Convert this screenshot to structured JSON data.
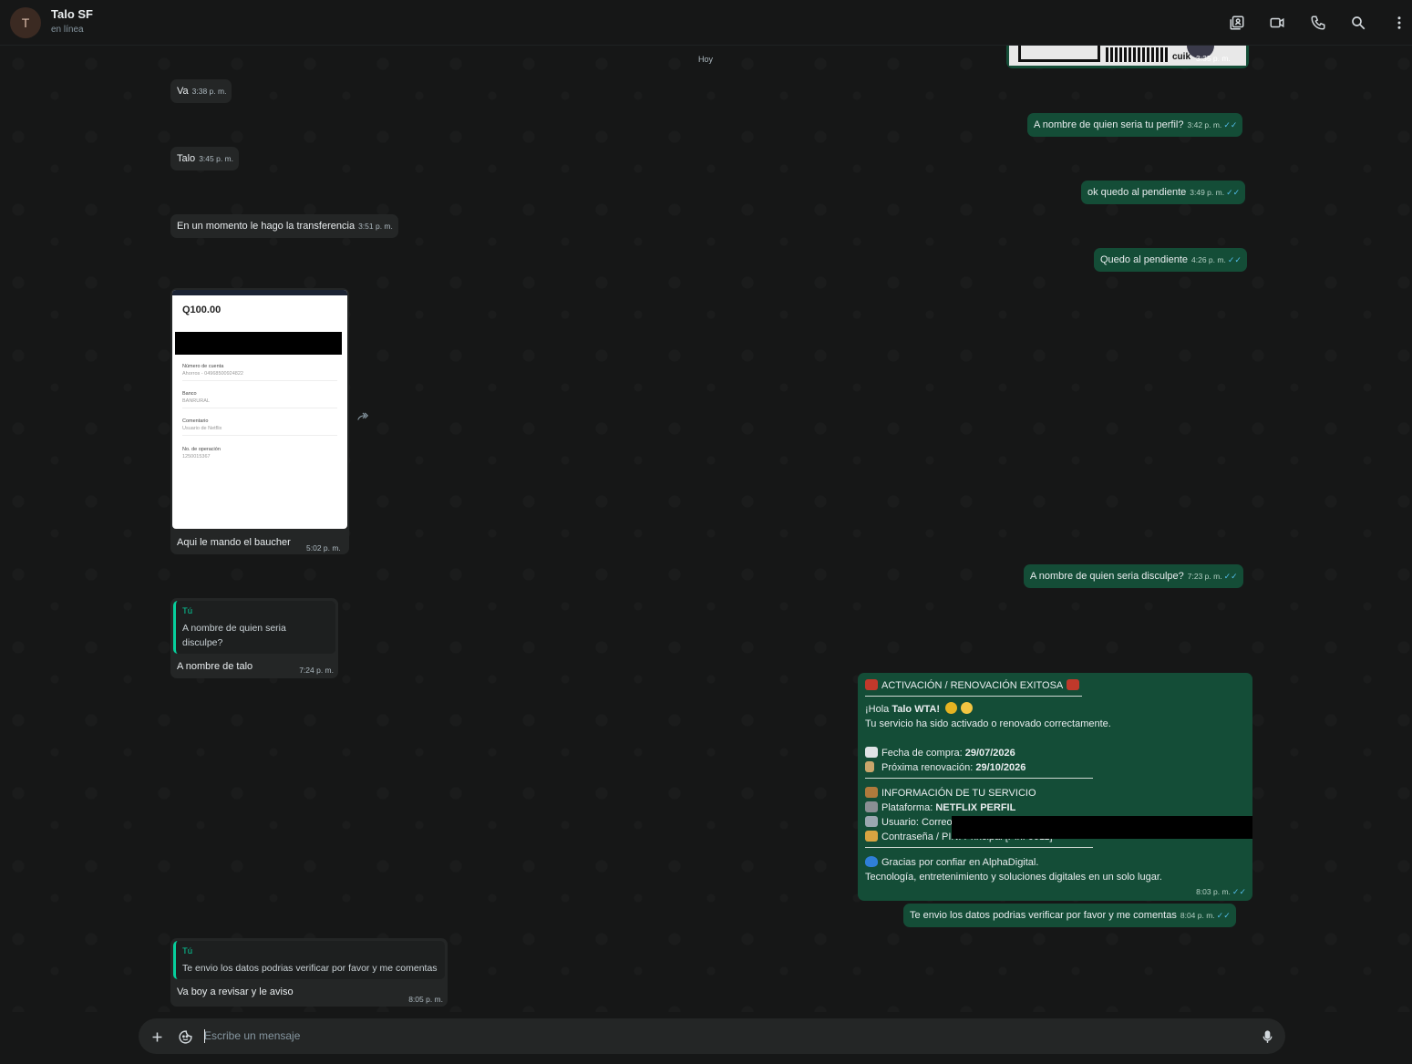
{
  "header": {
    "avatar_initial": "T",
    "contact_name": "Talo SF",
    "status": "en línea"
  },
  "chat": {
    "date_chip": "Hoy",
    "partial_out_time": "3:35 p. m.",
    "partial_out_overlay": "cuik",
    "messages_in": [
      {
        "text": "Va",
        "time": "3:38 p. m."
      },
      {
        "text": "Talo",
        "time": "3:45 p. m."
      },
      {
        "text": "En un momento  le hago la transferencia",
        "time": "3:51 p. m."
      },
      {
        "text": "Aqui le mando el baucher",
        "time": "5:02 p. m."
      },
      {
        "quote_author": "Tú",
        "quote_text": "A nombre de quien seria disculpe?",
        "text": "A nombre  de talo",
        "time": "7:24 p. m."
      },
      {
        "quote_author": "Tú",
        "quote_text": "Te envio los datos podrias verificar por favor y me comentas",
        "text": "Va boy  a revisar  y le aviso",
        "time": "8:05 p. m."
      }
    ],
    "messages_out": [
      {
        "text": "A nombre de quien seria tu perfil?",
        "time": "3:42 p. m."
      },
      {
        "text": "ok quedo al pendiente",
        "time": "3:49 p. m."
      },
      {
        "text": "Quedo al pendiente",
        "time": "4:26 p. m."
      },
      {
        "text": "A nombre de quien seria disculpe?",
        "time": "7:23 p. m."
      },
      {
        "text": "Te envio los datos podrias verificar por favor y me comentas",
        "time": "8:04 p. m."
      }
    ],
    "receipt": {
      "amount": "Q100.00",
      "fields": [
        {
          "label": "Número de cuenta",
          "value": "Ahorros - 04968500924822"
        },
        {
          "label": "Banco",
          "value": "BANRURAL"
        },
        {
          "label": "Comentario",
          "value": "Usuario  de Netflix"
        },
        {
          "label": "No. de operación",
          "value": "1250015367"
        }
      ]
    },
    "activation": {
      "title": "ACTIVACIÓN / RENOVACIÓN EXITOSA",
      "greeting_prefix": "¡Hola ",
      "greeting_name": "Talo WTA!",
      "line_service": "Tu servicio ha sido activado o renovado correctamente.",
      "purchase_label": "Fecha de compra: ",
      "purchase_date": "29/07/2026",
      "renewal_label": "Próxima renovación: ",
      "renewal_date": "29/10/2026",
      "info_title": "INFORMACIÓN DE TU SERVICIO",
      "platform_label": "Plataforma: ",
      "platform_value": "NETFLIX PERFIL",
      "user_label": "Usuario: Correo",
      "password_line": "Contraseña / PIN: Principal [Pin: 0011]",
      "thanks": "Gracias por confiar en AlphaDigital.",
      "tagline": "Tecnología, entretenimiento y soluciones digitales en un solo lugar.",
      "time": "8:03 p. m."
    },
    "ticks": "✓✓"
  },
  "composer": {
    "placeholder": "Escribe un mensaje"
  },
  "colors": {
    "incoming_bubble": "#242626",
    "outgoing_bubble": "#144d37",
    "accent": "#06cf9c",
    "read_ticks": "#53bdeb"
  },
  "icons": [
    "add-icon",
    "sticker-icon",
    "microphone-icon",
    "contact-card-icon",
    "video-call-icon",
    "phone-icon",
    "search-icon",
    "menu-icon",
    "forward-icon"
  ]
}
